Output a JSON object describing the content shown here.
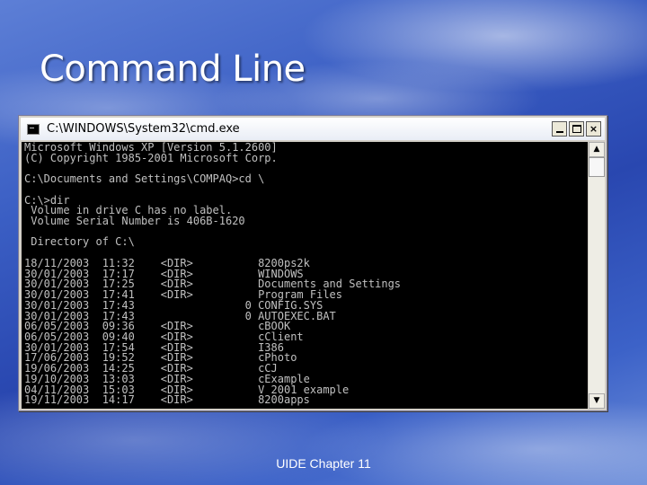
{
  "slide": {
    "title": "Command Line",
    "footer": "UIDE Chapter 11"
  },
  "window": {
    "title": "C:\\WINDOWS\\System32\\cmd.exe",
    "icon": "cmd-console-icon",
    "buttons": {
      "minimize": "minimize-icon",
      "maximize": "maximize-icon",
      "close_label": "×"
    }
  },
  "console": {
    "lines": [
      "Microsoft Windows XP [Version 5.1.2600]",
      "(C) Copyright 1985-2001 Microsoft Corp.",
      "",
      "C:\\Documents and Settings\\COMPAQ>cd \\",
      "",
      "C:\\>dir",
      " Volume in drive C has no label.",
      " Volume Serial Number is 406B-1620",
      "",
      " Directory of C:\\",
      "",
      "18/11/2003  11:32    <DIR>          8200ps2k",
      "30/01/2003  17:17    <DIR>          WINDOWS",
      "30/01/2003  17:25    <DIR>          Documents and Settings",
      "30/01/2003  17:41    <DIR>          Program Files",
      "30/01/2003  17:43                 0 CONFIG.SYS",
      "30/01/2003  17:43                 0 AUTOEXEC.BAT",
      "06/05/2003  09:36    <DIR>          cBOOK",
      "06/05/2003  09:40    <DIR>          cClient",
      "30/01/2003  17:54    <DIR>          I386",
      "17/06/2003  19:52    <DIR>          cPhoto",
      "19/06/2003  14:25    <DIR>          cCJ",
      "19/10/2003  13:03    <DIR>          cExample",
      "04/11/2003  15:03    <DIR>          V 2001 example",
      "19/11/2003  14:17    <DIR>          8200apps"
    ]
  },
  "scrollbar": {
    "up_arrow": "▲",
    "down_arrow": "▼"
  },
  "colors": {
    "console_bg": "#000000",
    "console_text": "#c0c0c0",
    "slide_bg": "#3b5fc4"
  }
}
